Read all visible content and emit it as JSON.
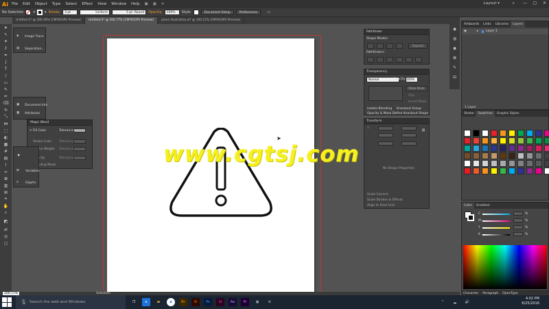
{
  "app": {
    "logo": "Ai",
    "workspace": "Layout"
  },
  "menu": [
    "File",
    "Edit",
    "Object",
    "Type",
    "Select",
    "Effect",
    "View",
    "Window",
    "Help"
  ],
  "control_bar": {
    "selection": "No Selection",
    "stroke_label": "Stroke:",
    "stroke_weight": "3 pt",
    "profile": "Uniform",
    "brush": "5 pt. Round",
    "opacity_label": "Opacity:",
    "opacity_value": "100%",
    "style_label": "Style:",
    "doc_setup": "Document Setup",
    "preferences": "Preferences"
  },
  "tabs": [
    "Untitled-1* @ 260.56% (CMYK/GPU Preview)",
    "Untitled-2* @ 200.77% (CMYK/GPU Preview)",
    "plane Illustration.ai* @ 160.21% (CMYK/GPU Preview)"
  ],
  "image_trace_panel": {
    "items": [
      "Image Trace",
      "Separation..."
    ]
  },
  "doc_info_panel": {
    "items": [
      "Document Info",
      "Attributes"
    ]
  },
  "magic_wand": {
    "title": "Magic Wand",
    "rows": [
      {
        "label": "Fill Color",
        "tol_label": "Tolerance:",
        "checked": true
      },
      {
        "label": "Stroke Color",
        "tol_label": "Tolerance:",
        "checked": false
      },
      {
        "label": "Stroke Weight",
        "tol_label": "Tolerance:",
        "checked": false
      },
      {
        "label": "Opacity",
        "tol_label": "Tolerance:",
        "checked": false
      },
      {
        "label": "Blending Mode",
        "tol_label": "",
        "checked": false
      }
    ]
  },
  "vars_panel": {
    "items": [
      "Variables",
      "Glyphs"
    ]
  },
  "watermark": "www.cgtsj.com",
  "pathfinder": {
    "title": "Pathfinder",
    "shape_modes": "Shape Modes:",
    "expand": "Expand",
    "pathfinders": "Pathfinders:"
  },
  "transparency": {
    "title": "Transparency",
    "mode": "Normal",
    "opacity_label": "Opacity:",
    "opacity": "100%",
    "make_mask": "Make Mask",
    "clip": "Clip",
    "invert_mask": "Invert Mask",
    "isolate": "Isolate Blending",
    "knockout": "Knockout Group",
    "opacity_mask": "Opacity & Mask Define Knockout Shape"
  },
  "transform": {
    "title": "Transform",
    "no_shape": "No Shape Properties",
    "scale_corners": "Scale Corners",
    "scale_strokes": "Scale Strokes & Effects",
    "align_pixel": "Align to Pixel Grid"
  },
  "layers_panel": {
    "tabs": [
      "Artboards",
      "Links",
      "Libraries",
      "Layers"
    ],
    "layer_name": "Layer 1",
    "footer": "1 Layer"
  },
  "swatches_panel": {
    "tabs": [
      "Stroke",
      "Swatches",
      "Graphic Styles"
    ],
    "colors": [
      "#ffffff",
      "#000000",
      "#ffffff",
      "#e8202a",
      "#f29a1f",
      "#fff200",
      "#00a651",
      "#00aeef",
      "#2e3192",
      "#ec008c",
      "#e8202a",
      "#ee4036",
      "#f7941d",
      "#fbb040",
      "#fff200",
      "#d7df23",
      "#8dc63f",
      "#39b54a",
      "#00a651",
      "#009444",
      "#00a79d",
      "#27aae1",
      "#1c75bc",
      "#2b3990",
      "#262262",
      "#662d91",
      "#92278f",
      "#9e1f63",
      "#da1c5c",
      "#ee2a7b",
      "#754c29",
      "#8b5e3c",
      "#a97c50",
      "#c49a6c",
      "#603913",
      "#3c2415",
      "#bcbec0",
      "#939598",
      "#6d6e71",
      "#414042",
      "#ffffff",
      "#e6e7e8",
      "#d1d3d4",
      "#bcbec0",
      "#a7a9ac",
      "#939598",
      "#808285",
      "#6d6e71",
      "#58595b",
      "#414042",
      "#ed1c24",
      "#f15a29",
      "#f7941d",
      "#fff200",
      "#39b54a",
      "#00aeef",
      "#2e3192",
      "#92278f",
      "#ec008c",
      "#ffffff"
    ]
  },
  "color_panel": {
    "tabs": [
      "Color",
      "Gradient"
    ],
    "channels": [
      "C",
      "M",
      "Y",
      "K"
    ],
    "unit": "%"
  },
  "char_panel": {
    "tabs": [
      "Character",
      "Paragraph",
      "OpenType"
    ]
  },
  "status": {
    "zoom": "200.77%",
    "tool": "Selection"
  },
  "taskbar": {
    "search": "Search the web and Windows",
    "time": "4:02 PM",
    "date": "6/25/2016"
  },
  "colors": {
    "accent": "#ff9a00",
    "stroke": "#111111",
    "watermark": "#f6f020"
  }
}
